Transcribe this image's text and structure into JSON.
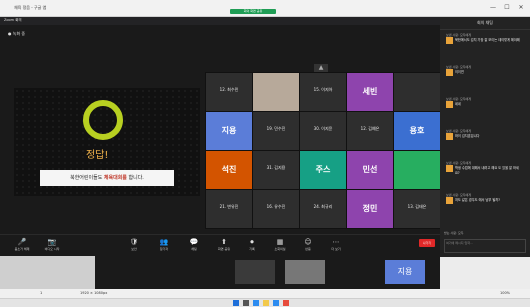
{
  "browser": {
    "tab_title": "체육 정음 - 구글 앱"
  },
  "zoom": {
    "window_title": "Zoom 회의",
    "sharing_pill": "회의 화면 공유",
    "top_status": "● 녹화 중"
  },
  "slide": {
    "answer": "정답!",
    "hint_prefix": "북한어린이들도 ",
    "hint_bold": "체육대회를",
    "hint_suffix": " 합니다."
  },
  "gallery": {
    "tiles": [
      {
        "name": "12. 최수민",
        "big": "",
        "color": "#2e2e2e"
      },
      {
        "name": "",
        "big": "",
        "color": "#b7a99a"
      },
      {
        "name": "15. 이지아",
        "big": "",
        "color": "#2e2e2e"
      },
      {
        "name": "",
        "big": "세빈",
        "color": "#8e44ad"
      },
      {
        "name": "",
        "big": "",
        "color": "#2e2e2e"
      },
      {
        "name": "",
        "big": "지용",
        "color": "#5b7dd8"
      },
      {
        "name": "19. 민수진",
        "big": "",
        "color": "#2e2e2e"
      },
      {
        "name": "30. 이지윤",
        "big": "",
        "color": "#2e2e2e"
      },
      {
        "name": "12. 김예은",
        "big": "",
        "color": "#2e2e2e"
      },
      {
        "name": "",
        "big": "용호",
        "color": "#3b6fd1"
      },
      {
        "name": "",
        "big": "석진",
        "color": "#d35400"
      },
      {
        "name": "31. 김지용",
        "big": "",
        "color": "#2e2e2e"
      },
      {
        "name": "",
        "big": "주스",
        "color": "#16a085"
      },
      {
        "name": "",
        "big": "민선",
        "color": "#8e44ad"
      },
      {
        "name": "",
        "big": "",
        "color": "#27ae60"
      },
      {
        "name": "21. 변유진",
        "big": "",
        "color": "#2e2e2e"
      },
      {
        "name": "16. 유수진",
        "big": "",
        "color": "#2e2e2e"
      },
      {
        "name": "24. 최규리",
        "big": "",
        "color": "#2e2e2e"
      },
      {
        "name": "",
        "big": "정민",
        "color": "#8e44ad"
      },
      {
        "name": "13. 김태은",
        "big": "",
        "color": "#2e2e2e"
      }
    ]
  },
  "toolbar": {
    "items": [
      {
        "icon": "🎤",
        "label": "음소거 해제"
      },
      {
        "icon": "📷",
        "label": "비디오 시작"
      },
      {
        "icon": "🛡",
        "label": "보안"
      },
      {
        "icon": "👥",
        "label": "참가자"
      },
      {
        "icon": "💬",
        "label": "채팅"
      },
      {
        "icon": "⬆",
        "label": "화면 공유"
      },
      {
        "icon": "⏺",
        "label": "기록"
      },
      {
        "icon": "▦",
        "label": "소회의실"
      },
      {
        "icon": "☺",
        "label": "반응"
      },
      {
        "icon": "⋯",
        "label": "더 보기"
      }
    ],
    "end": "나가기"
  },
  "chat": {
    "header": "회의 채팅",
    "messages": [
      {
        "from": "보낸 사람: 모두에게",
        "text": "북한에서도 김치 가장 잘 보이는 데이렇게 해야해"
      },
      {
        "from": "보낸 사람: 모두에게",
        "text": "이이연"
      },
      {
        "from": "보낸 사람: 모두에게",
        "text": "네네"
      },
      {
        "from": "보낸 사람: 모두에게",
        "text": "하이 김지훈입니다"
      },
      {
        "from": "보낸 사람: 모두에게",
        "text": "학생 수업에 대해서 내려고 해요 도 있을 잘 하세요?"
      },
      {
        "from": "보낸 사람: 모두에게",
        "text": "저도 같은 경우도 에서 남부 될까?"
      }
    ],
    "to_label": "받는 사람: 모두",
    "placeholder": "여기에 메시지 입력..."
  },
  "status": {
    "page": "1",
    "resolution": "1920 × 1080px",
    "zoom_pct": "100%"
  }
}
